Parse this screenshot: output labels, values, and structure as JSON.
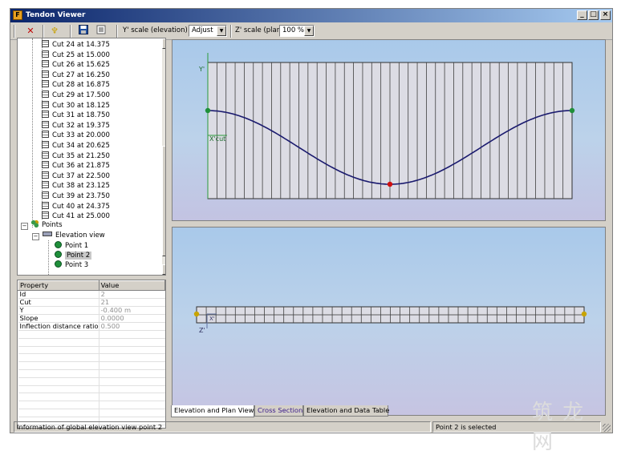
{
  "window": {
    "title": "Tendon Viewer",
    "minimize": "_",
    "maximize": "□",
    "close": "×"
  },
  "toolbar": {
    "delete_icon": "x-icon",
    "pin_icon": "pin-icon",
    "save_icon": "disk-icon",
    "list_icon": "list-icon",
    "y_scale_label": "Y' scale (elevation)",
    "y_scale_value": "Adjust",
    "z_scale_label": "Z' scale (plan)",
    "z_scale_value": "100 %"
  },
  "tree": {
    "cuts": [
      "Cut 24 at 14.375",
      "Cut 25 at 15.000",
      "Cut 26 at 15.625",
      "Cut 27 at 16.250",
      "Cut 28 at 16.875",
      "Cut 29 at 17.500",
      "Cut 30 at 18.125",
      "Cut 31 at 18.750",
      "Cut 32 at 19.375",
      "Cut 33 at 20.000",
      "Cut 34 at 20.625",
      "Cut 35 at 21.250",
      "Cut 36 at 21.875",
      "Cut 37 at 22.500",
      "Cut 38 at 23.125",
      "Cut 39 at 23.750",
      "Cut 40 at 24.375",
      "Cut 41 at 25.000"
    ],
    "points_label": "Points",
    "elevation_view_label": "Elevation view",
    "point_items": [
      "Point 1",
      "Point 2",
      "Point 3"
    ],
    "selected_point": "Point 2",
    "expand_minus": "−"
  },
  "properties": {
    "header_property": "Property",
    "header_value": "Value",
    "rows": [
      {
        "property": "Id",
        "value": "2"
      },
      {
        "property": "Cut",
        "value": "21"
      },
      {
        "property": "Y",
        "value": "-0.400 m"
      },
      {
        "property": "Slope",
        "value": "0.0000"
      },
      {
        "property": "Inflection distance ratio",
        "value": "0.500"
      }
    ]
  },
  "elevation_view": {
    "y_axis_label": "Y'",
    "x_axis_label": "X'cut",
    "grid_columns": 40,
    "tendon_color": "#1a1a6e",
    "end_point_color": "#1f8f3a",
    "selected_point_color": "#d01010"
  },
  "plan_view": {
    "z_axis_label": "Z'",
    "x_axis_label": "X'",
    "grid_columns": 40,
    "end_point_color": "#c8a400"
  },
  "tabs": [
    {
      "label": "Elevation and Plan Views",
      "active": true
    },
    {
      "label": "Cross Section",
      "active": false
    },
    {
      "label": "Elevation and Data Table",
      "active": false
    }
  ],
  "status": {
    "info": "Information of global elevation view point 2",
    "selection": "Point 2 is selected"
  },
  "watermark": "筑 龙 网"
}
